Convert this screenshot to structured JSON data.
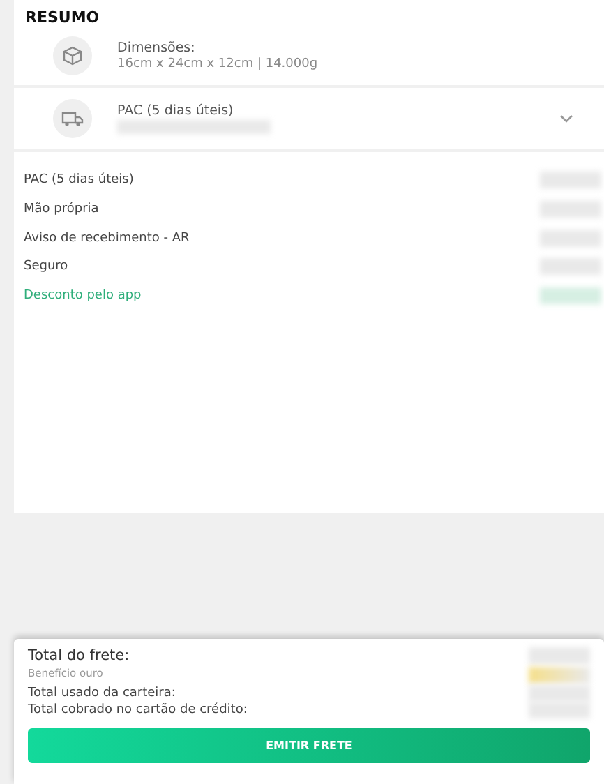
{
  "summary": {
    "title": "RESUMO",
    "package": {
      "label": "Dimensões:",
      "value": "16cm x 24cm x 12cm | 14.000g"
    },
    "service": {
      "label": "PAC (5 dias úteis)",
      "expanded": false
    },
    "lines": [
      {
        "label": "PAC (5 dias úteis)",
        "kind": "normal"
      },
      {
        "label": "Mão própria",
        "kind": "normal"
      },
      {
        "label": "Aviso de recebimento - AR",
        "kind": "normal"
      },
      {
        "label": "Seguro",
        "kind": "normal"
      },
      {
        "label": "Desconto pelo app",
        "kind": "discount"
      }
    ]
  },
  "totals": {
    "freight": "Total do frete:",
    "benefit": "Benefício ouro",
    "wallet": "Total usado da carteira:",
    "card": "Total cobrado no cartão de crédito:"
  },
  "button": "EMITIR FRETE"
}
